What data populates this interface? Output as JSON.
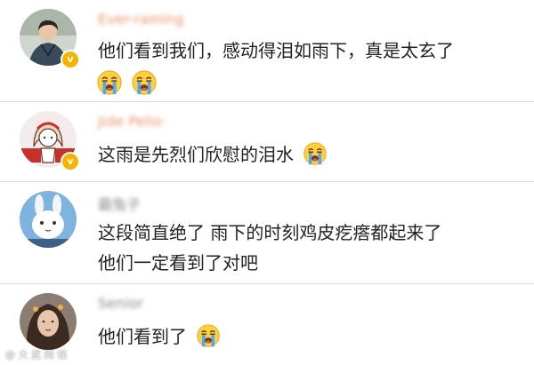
{
  "comments": [
    {
      "username": "Ever-raining",
      "text": "他们看到我们，感动得泪如雨下，真是太玄了",
      "emoji": "loudly-crying-face-emoji",
      "emoji_count": 2,
      "verified": true
    },
    {
      "username": "Jide Pelio·",
      "text": "这雨是先烈们欣慰的泪水",
      "emoji": "loudly-crying-face-emoji",
      "verified": true
    },
    {
      "username": "霸兔子",
      "text_line1": "这段简直绝了 雨下的时刻鸡皮疙瘩都起来了",
      "text_line2": "他们一定看到了对吧",
      "verified": false
    },
    {
      "username": "Senior",
      "text": "他们看到了",
      "emoji": "loudly-crying-face-emoji",
      "verified": false
    }
  ],
  "colors": {
    "username_orange": "#e8936b",
    "username_gray": "#8a8a8a",
    "text": "#222222",
    "divider": "#d9d9d9",
    "verified_badge": "#f5b400",
    "emoji_face": "#ffcf3d"
  },
  "icons": {
    "verified": "verified-badge-icon",
    "crying": "loudly-crying-face-emoji"
  }
}
